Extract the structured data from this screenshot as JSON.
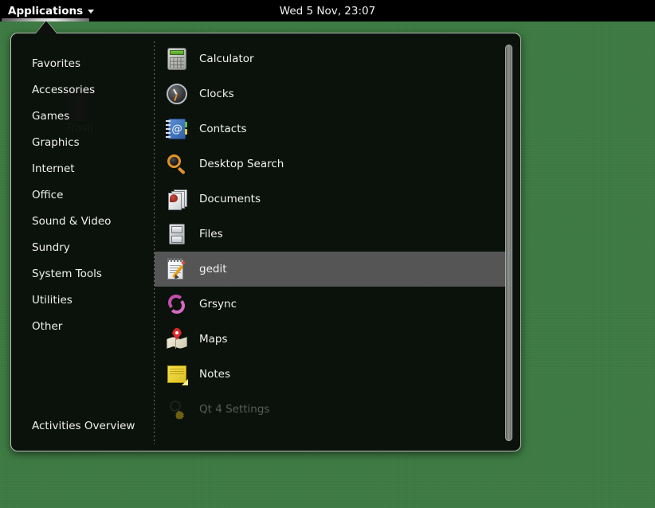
{
  "topbar": {
    "applications_label": "Applications",
    "applications_caret": "chevron-down-icon",
    "clock": "Wed  5 Nov, 23:07"
  },
  "desktop": {
    "background_color": "#3d7a42",
    "icons": [
      {
        "name": "trash",
        "label": "Trash"
      }
    ]
  },
  "menu": {
    "panel_background": "#080a08",
    "border_color": "#b9bdb9",
    "categories": [
      {
        "label": "Favorites"
      },
      {
        "label": "Accessories"
      },
      {
        "label": "Games"
      },
      {
        "label": "Graphics"
      },
      {
        "label": "Internet"
      },
      {
        "label": "Office"
      },
      {
        "label": "Sound & Video"
      },
      {
        "label": "Sundry"
      },
      {
        "label": "System Tools"
      },
      {
        "label": "Utilities"
      },
      {
        "label": "Other"
      }
    ],
    "activities_overview_label": "Activities Overview",
    "selected_highlight_color": "#555555",
    "applications": [
      {
        "label": "Calculator",
        "icon": "calculator-icon",
        "selected": false,
        "dimmed": false
      },
      {
        "label": "Clocks",
        "icon": "clock-icon",
        "selected": false,
        "dimmed": false
      },
      {
        "label": "Contacts",
        "icon": "contacts-book-icon",
        "selected": false,
        "dimmed": false
      },
      {
        "label": "Desktop Search",
        "icon": "magnifier-icon",
        "selected": false,
        "dimmed": false
      },
      {
        "label": "Documents",
        "icon": "documents-icon",
        "selected": false,
        "dimmed": false
      },
      {
        "label": "Files",
        "icon": "file-cabinet-icon",
        "selected": false,
        "dimmed": false
      },
      {
        "label": "gedit",
        "icon": "notepad-pencil-icon",
        "selected": true,
        "dimmed": false
      },
      {
        "label": "Grsync",
        "icon": "sync-arrows-icon",
        "selected": false,
        "dimmed": false
      },
      {
        "label": "Maps",
        "icon": "map-pin-icon",
        "selected": false,
        "dimmed": false
      },
      {
        "label": "Notes",
        "icon": "sticky-note-icon",
        "selected": false,
        "dimmed": false
      },
      {
        "label": "Qt 4 Settings",
        "icon": "qt-gear-icon",
        "selected": false,
        "dimmed": true
      }
    ]
  }
}
